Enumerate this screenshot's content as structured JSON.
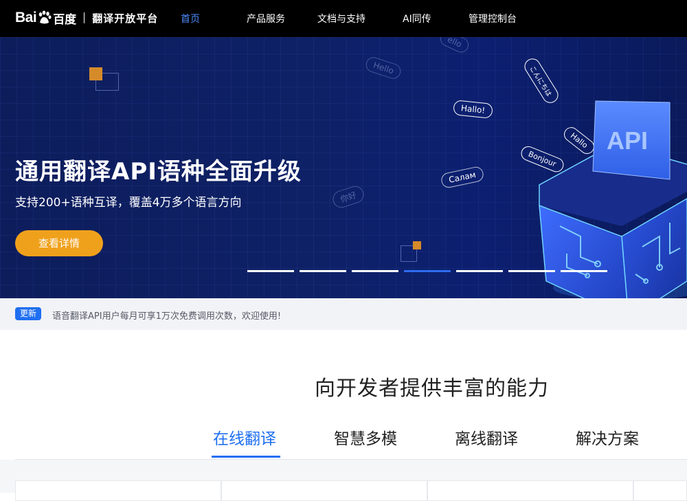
{
  "brand": {
    "bai": "Bai",
    "du": "百度",
    "subtitle": "翻译开放平台"
  },
  "nav": [
    {
      "label": "首页",
      "active": true
    },
    {
      "label": "产品服务"
    },
    {
      "label": "文档与支持"
    },
    {
      "label": "AI同传"
    },
    {
      "label": "管理控制台"
    }
  ],
  "banner": {
    "title": "通用翻译API语种全面升级",
    "subtitle": "支持200+语种互译，覆盖4万多个语言方向",
    "button": "查看详情",
    "api_label": "API",
    "bubbles": [
      "Hallo!",
      "Hallo",
      "Bonjour",
      "Салам",
      "你好",
      "こんにちは",
      "Hello",
      "ello"
    ],
    "slides": 7,
    "active_slide": 4
  },
  "notice": {
    "tag": "更新",
    "text": "语音翻译API用户每月可享1万次免费调用次数，欢迎使用!"
  },
  "capabilities": {
    "title": "向开发者提供丰富的能力",
    "tabs": [
      {
        "label": "在线翻译",
        "active": true
      },
      {
        "label": "智慧多模"
      },
      {
        "label": "离线翻译"
      },
      {
        "label": "解决方案"
      }
    ]
  },
  "colors": {
    "accent": "#1f6ff0",
    "button": "#f0a11c",
    "banner": "#0e2166"
  }
}
